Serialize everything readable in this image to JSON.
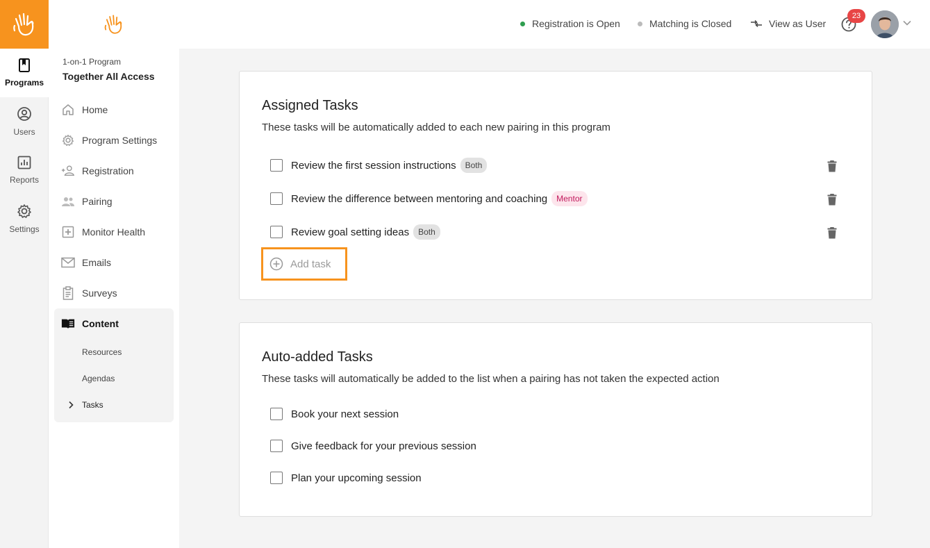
{
  "rail": {
    "items": [
      {
        "label": "Programs",
        "icon": "book-icon"
      },
      {
        "label": "Users",
        "icon": "user-circle-icon"
      },
      {
        "label": "Reports",
        "icon": "chart-icon"
      },
      {
        "label": "Settings",
        "icon": "gear-icon"
      }
    ]
  },
  "sidebar": {
    "program_type": "1-on-1 Program",
    "program_name": "Together All Access",
    "items": [
      {
        "label": "Home"
      },
      {
        "label": "Program Settings"
      },
      {
        "label": "Registration"
      },
      {
        "label": "Pairing"
      },
      {
        "label": "Monitor Health"
      },
      {
        "label": "Emails"
      },
      {
        "label": "Surveys"
      }
    ],
    "content": {
      "label": "Content",
      "subitems": [
        {
          "label": "Resources"
        },
        {
          "label": "Agendas"
        },
        {
          "label": "Tasks"
        }
      ]
    }
  },
  "topbar": {
    "registration_status": "Registration is Open",
    "matching_status": "Matching is Closed",
    "view_as_user": "View as User",
    "notification_count": "23",
    "colors": {
      "open": "#2e9e4f",
      "closed": "#bbbbbb",
      "badge": "#e84545"
    }
  },
  "assigned": {
    "title": "Assigned Tasks",
    "description": "These tasks will be automatically added to each new pairing in this program",
    "tasks": [
      {
        "label": "Review the first session instructions",
        "tag": "Both"
      },
      {
        "label": "Review the difference between mentoring and coaching",
        "tag": "Mentor"
      },
      {
        "label": "Review goal setting ideas",
        "tag": "Both"
      }
    ],
    "add_label": "Add task"
  },
  "auto": {
    "title": "Auto-added Tasks",
    "description": "These tasks will automatically be added to the list when a pairing has not taken the expected action",
    "tasks": [
      {
        "label": "Book your next session"
      },
      {
        "label": "Give feedback for your previous session"
      },
      {
        "label": "Plan your upcoming session"
      }
    ]
  },
  "accent_color": "#f7931e"
}
